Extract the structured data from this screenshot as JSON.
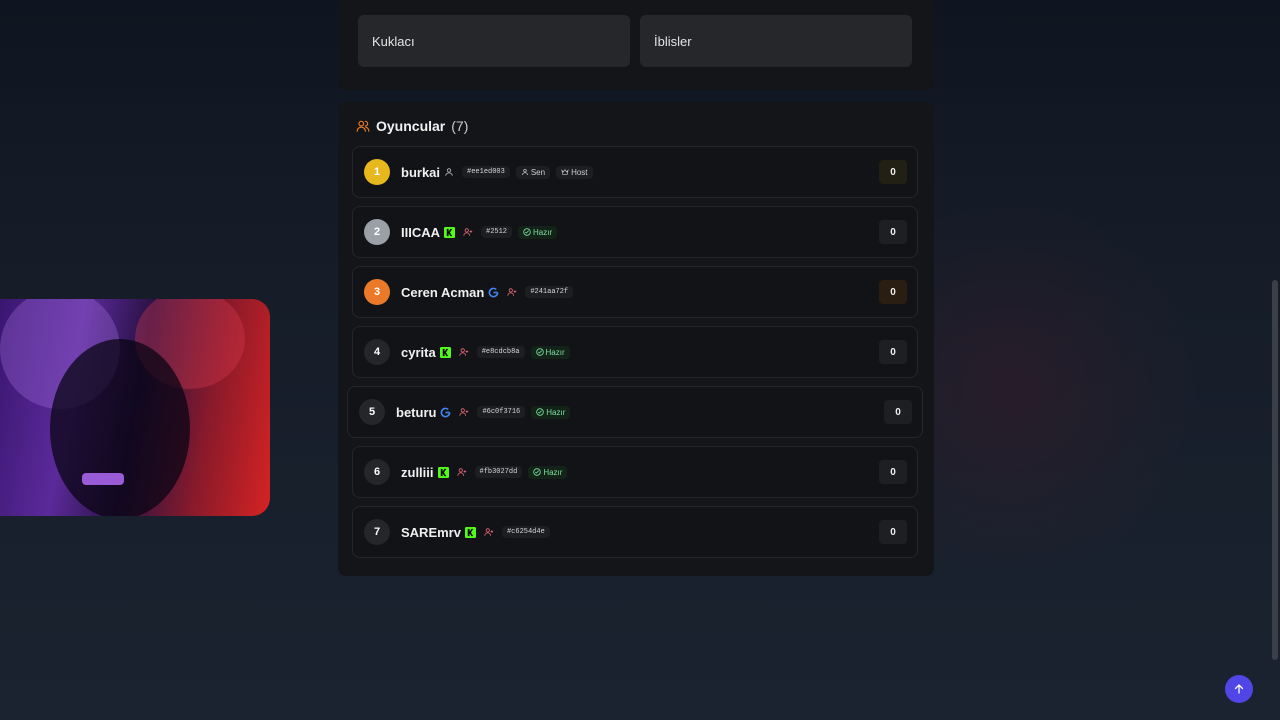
{
  "roles": {
    "cards": [
      {
        "label": "Kuklacı"
      },
      {
        "label": "İblisler"
      }
    ]
  },
  "players": {
    "title": "Oyuncular",
    "count": "(7)",
    "list": [
      {
        "rank": "1",
        "name": "burkai",
        "tag": "#ee1ed003",
        "badges": [
          "Sen",
          "Host"
        ],
        "score": "0",
        "rank_color": "#e6b81e",
        "login": "none"
      },
      {
        "rank": "2",
        "name": "IIICAA",
        "tag": "#2512",
        "ready": "Hazır",
        "score": "0",
        "rank_color": "#9aa0a8",
        "login": "kick"
      },
      {
        "rank": "3",
        "name": "Ceren Acman",
        "tag": "#241aa72f",
        "score": "0",
        "rank_color": "#ea7a2a",
        "login": "google"
      },
      {
        "rank": "4",
        "name": "cyrita",
        "tag": "#e8cdcb8a",
        "ready": "Hazır",
        "score": "0",
        "login": "kick"
      },
      {
        "rank": "5",
        "name": "beturu",
        "tag": "#6c0f3716",
        "ready": "Hazır",
        "score": "0",
        "login": "google"
      },
      {
        "rank": "6",
        "name": "zulliii",
        "tag": "#fb3027dd",
        "ready": "Hazır",
        "score": "0",
        "login": "kick"
      },
      {
        "rank": "7",
        "name": "SAREmrv",
        "tag": "#c6254d4e",
        "score": "0",
        "login": "kick"
      }
    ]
  },
  "icons": {
    "players": "users-icon",
    "self": "user-icon",
    "guest": "user-add-icon",
    "host": "crown-icon",
    "ready": "check-circle-icon",
    "kick": "kick-logo-icon",
    "google": "google-logo-icon",
    "scroll_top": "arrow-up-icon"
  },
  "colors": {
    "accent": "#4f46e5",
    "ready": "#7be0a0",
    "kick": "#53fc18",
    "orange": "#ea7a2a"
  }
}
